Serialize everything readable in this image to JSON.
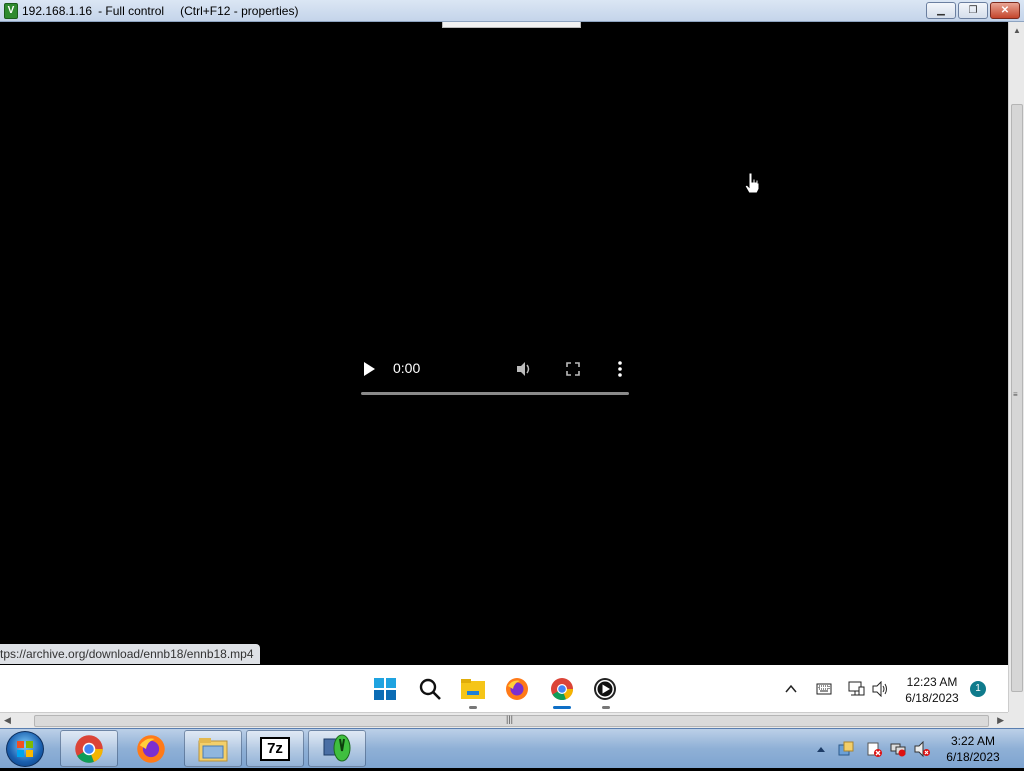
{
  "window": {
    "title_ip": "192.168.1.16",
    "title_mode": "- Full control",
    "title_hint": "(Ctrl+F12 - properties)",
    "app_icon_letter": "V"
  },
  "video": {
    "time": "0:00",
    "progress": 0
  },
  "status": {
    "url": "tps://archive.org/download/ennb18/ennb18.mp4"
  },
  "remote_taskbar": {
    "icons": [
      "windows-start-icon",
      "search-icon",
      "file-explorer-icon",
      "firefox-icon",
      "chrome-icon",
      "media-player-icon"
    ],
    "clock_time": "12:23 AM",
    "clock_date": "6/18/2023",
    "notification_count": "1"
  },
  "win7_taskbar": {
    "pinned": [
      "chrome-icon",
      "firefox-icon",
      "file-explorer-icon",
      "7zip-icon",
      "vnc-viewer-icon"
    ],
    "sevenzip_label": "7z",
    "clock_time": "3:22 AM",
    "clock_date": "6/18/2023"
  }
}
